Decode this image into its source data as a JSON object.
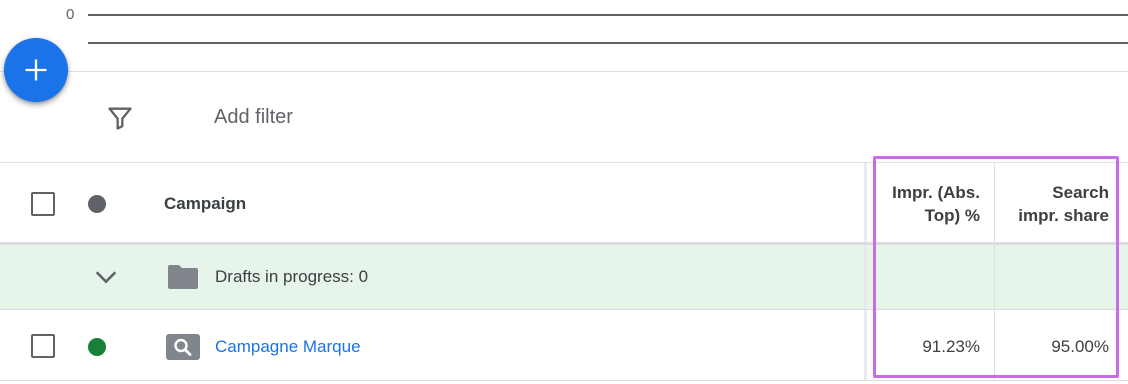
{
  "chart": {
    "axis_zero_label": "0"
  },
  "fab": {
    "icon": "plus-icon"
  },
  "filter": {
    "icon": "filter-icon",
    "add_filter_label": "Add filter"
  },
  "table": {
    "columns": {
      "campaign": "Campaign",
      "impr_abs_top_line1": "Impr. (Abs.",
      "impr_abs_top_line2": "Top) %",
      "search_impr_share_line1": "Search",
      "search_impr_share_line2": "impr. share"
    },
    "draft_row": {
      "label": "Drafts in progress: 0"
    },
    "rows": [
      {
        "campaign": "Campagne Marque",
        "status_color": "#188038",
        "impr_abs_top": "91.23%",
        "search_impr_share": "95.00%"
      }
    ]
  },
  "colors": {
    "accent": "#1a73e8",
    "highlight": "#c86dea",
    "status_enabled": "#188038",
    "draft_bg": "#e6f4ea"
  }
}
